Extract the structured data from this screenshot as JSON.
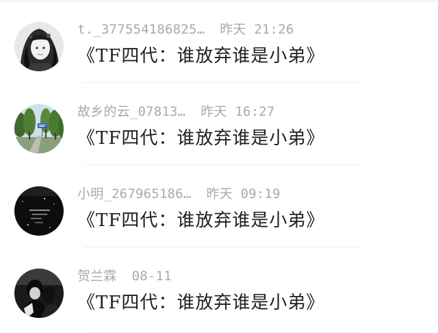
{
  "comments": [
    {
      "username": "t._377554186825…",
      "time": "昨天 21:26",
      "text": "《TF四代：谁放弃谁是小弟》",
      "avatar_icon": "anime-character-avatar"
    },
    {
      "username": "故乡的云_07813…",
      "time": "昨天 16:27",
      "text": "《TF四代：谁放弃谁是小弟》",
      "avatar_icon": "tree-road-avatar"
    },
    {
      "username": "小明_267965186…",
      "time": "昨天 09:19",
      "text": "《TF四代：谁放弃谁是小弟》",
      "avatar_icon": "dark-text-avatar"
    },
    {
      "username": "贺兰霖",
      "time": "08-11",
      "text": "《TF四代：谁放弃谁是小弟》",
      "avatar_icon": "person-dark-avatar"
    }
  ],
  "colors": {
    "meta_text": "#a9a9a9",
    "body_text": "#1f1f1f",
    "divider": "#ededed"
  }
}
